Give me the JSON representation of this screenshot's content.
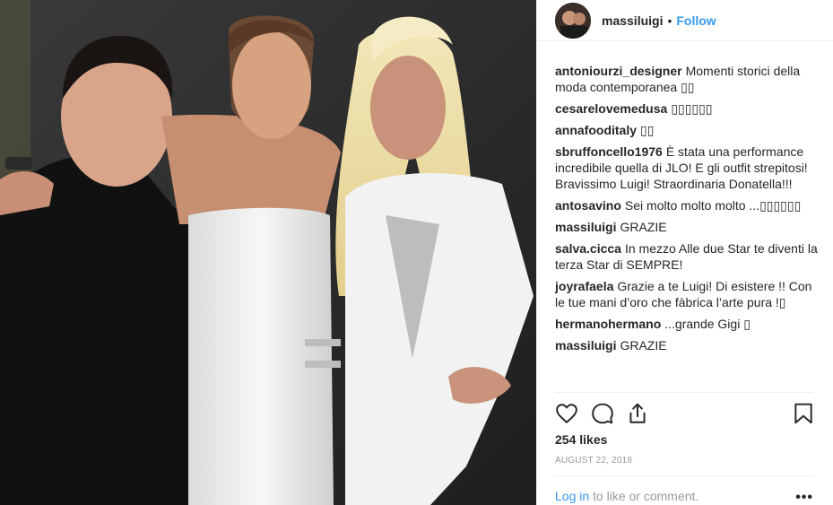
{
  "header": {
    "username": "massiluigi",
    "separator": "•",
    "follow_label": "Follow"
  },
  "comments": [
    {
      "user": "antoniourzi_designer",
      "text": "Momenti storici della moda contemporanea ▯▯"
    },
    {
      "user": "cesarelovemedusa",
      "text": "▯▯▯▯▯▯"
    },
    {
      "user": "annafooditaly",
      "text": "▯▯"
    },
    {
      "user": "sbruffoncello1976",
      "text": "È stata una performance incredibile quella di JLO! E gli outfit strepitosi! Bravissimo Luigi! Straordinaria Donatella!!!"
    },
    {
      "user": "antosavino",
      "text": "Sei molto molto molto ...▯▯▯▯▯▯"
    },
    {
      "user": "massiluigi",
      "text": "GRAZIE"
    },
    {
      "user": "salva.cicca",
      "text": "In mezzo Alle due Star te diventi la terza Star di SEMPRE!"
    },
    {
      "user": "joyrafaela",
      "text": "Grazie a te Luigi! Di esistere !! Con le tue mani d’oro che fàbrica l’arte pura !▯"
    },
    {
      "user": "hermanohermano",
      "text": "...grande Gigi ▯"
    },
    {
      "user": "massiluigi",
      "text": "GRAZIE"
    }
  ],
  "likes": "254 likes",
  "date": "AUGUST 22, 2018",
  "login": {
    "link": "Log in",
    "rest": " to like or comment."
  },
  "more_label": "•••",
  "icons": {
    "like": "heart-icon",
    "comment": "comment-bubble-icon",
    "share": "share-icon",
    "save": "bookmark-icon",
    "more": "more-options-icon"
  },
  "colors": {
    "link_blue": "#3897f0",
    "text": "#262626",
    "muted": "#999999",
    "divider": "#efefef"
  }
}
